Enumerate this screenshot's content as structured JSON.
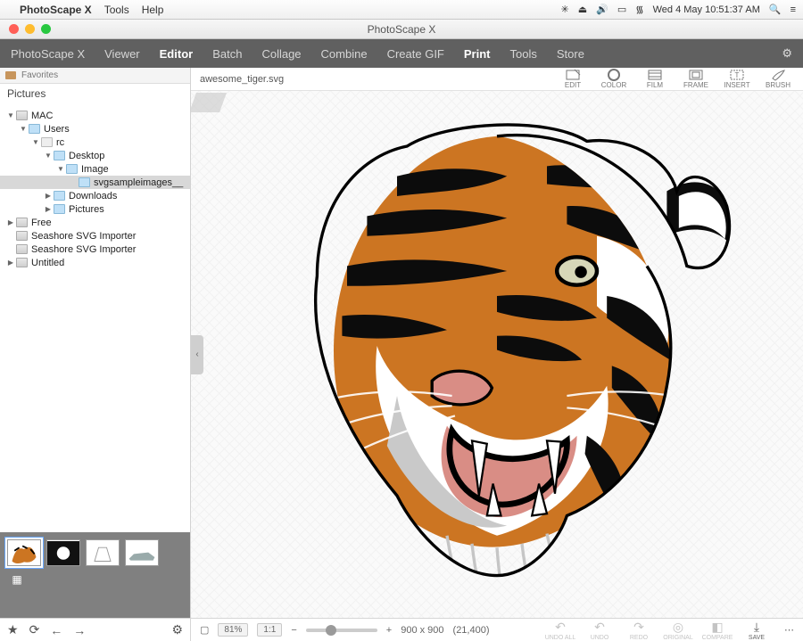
{
  "menubar": {
    "app": "PhotoScape X",
    "items": [
      "Tools",
      "Help"
    ],
    "datetime": "Wed 4 May  10:51:37 AM"
  },
  "window": {
    "title": "PhotoScape X"
  },
  "tabs": [
    "PhotoScape X",
    "Viewer",
    "Editor",
    "Batch",
    "Collage",
    "Combine",
    "Create GIF",
    "Print",
    "Tools",
    "Store"
  ],
  "active_tab": "Editor",
  "favorites_label": "Favorites",
  "pictures_label": "Pictures",
  "tree": [
    {
      "depth": 0,
      "arrow": "▼",
      "icon": "drive",
      "label": "MAC"
    },
    {
      "depth": 1,
      "arrow": "▼",
      "icon": "folder",
      "label": "Users"
    },
    {
      "depth": 2,
      "arrow": "▼",
      "icon": "home",
      "label": "rc"
    },
    {
      "depth": 3,
      "arrow": "▼",
      "icon": "folder",
      "label": "Desktop"
    },
    {
      "depth": 4,
      "arrow": "▼",
      "icon": "folder",
      "label": "Image"
    },
    {
      "depth": 5,
      "arrow": "",
      "icon": "folder",
      "label": "svgsampleimages__",
      "selected": true
    },
    {
      "depth": 3,
      "arrow": "▶",
      "icon": "folder",
      "label": "Downloads"
    },
    {
      "depth": 3,
      "arrow": "▶",
      "icon": "folder",
      "label": "Pictures"
    },
    {
      "depth": 0,
      "arrow": "▶",
      "icon": "drive",
      "label": "Free"
    },
    {
      "depth": 0,
      "arrow": "",
      "icon": "drive",
      "label": "Seashore SVG Importer"
    },
    {
      "depth": 0,
      "arrow": "",
      "icon": "drive",
      "label": "Seashore SVG Importer"
    },
    {
      "depth": 0,
      "arrow": "▶",
      "icon": "drive",
      "label": "Untitled"
    }
  ],
  "current_file": "awesome_tiger.svg",
  "right_tools": [
    "EDIT",
    "COLOR",
    "FILM",
    "FRAME",
    "INSERT",
    "BRUSH"
  ],
  "zoom_percent": "81%",
  "zoom_ratio": "1:1",
  "dimensions": "900 x 900",
  "pixel_count": "(21,400)",
  "history_tools": [
    "UNDO ALL",
    "UNDO",
    "REDO",
    "ORIGINAL",
    "COMPARE",
    "SAVE"
  ],
  "colors": {
    "tiger_orange": "#cc7522",
    "tiger_black": "#0c0c0c",
    "tiger_pink": "#d98d85"
  }
}
